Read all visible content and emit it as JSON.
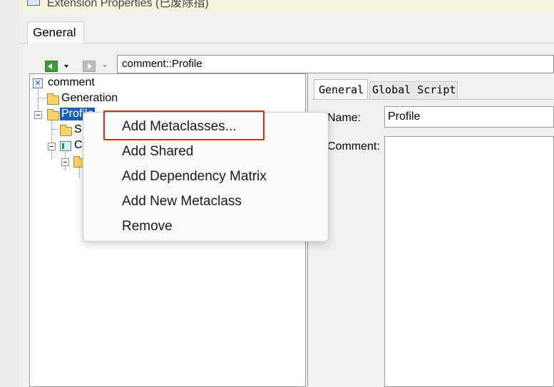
{
  "window": {
    "title": "Extension Properties (已废除指)"
  },
  "main_tab": {
    "label": "General"
  },
  "toolbar": {
    "back_icon": "arrow-left-green-icon",
    "forward_icon": "arrow-right-gray-icon"
  },
  "path": {
    "value": "comment::Profile"
  },
  "tree": {
    "root": "comment",
    "generation": "Generation",
    "profile": "Profile",
    "shared_partial": "S",
    "class_partial": "C"
  },
  "properties": {
    "tabs": [
      "General",
      "Global Script"
    ],
    "name_label": "Name:",
    "name_value": "Profile",
    "comment_label": "Comment:",
    "comment_value": ""
  },
  "context_menu": {
    "items": [
      "Add Metaclasses...",
      "Add Shared",
      "Add Dependency Matrix",
      "Add New Metaclass",
      "Remove"
    ]
  },
  "colors": {
    "highlight": "#e1251b",
    "selection": "#1a5fb4"
  }
}
